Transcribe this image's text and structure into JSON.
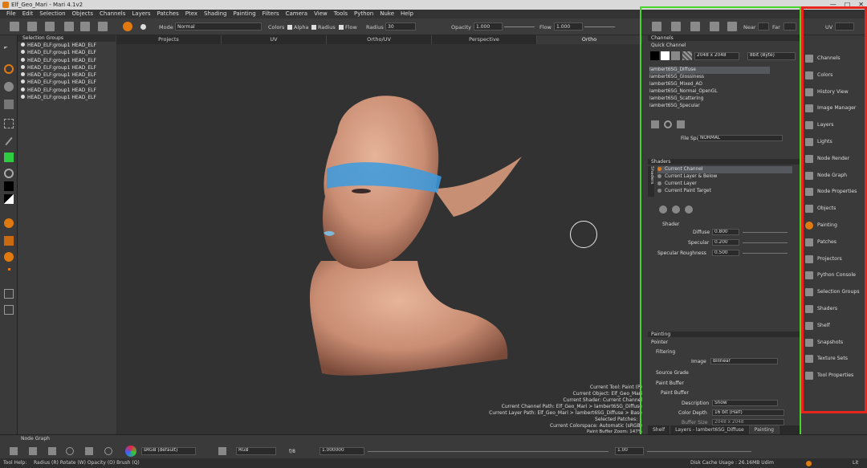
{
  "titlebar": {
    "title": "Elf_Geo_Mari - Mari 4.1v2",
    "min": "—",
    "max": "□",
    "close": "✕"
  },
  "menu": [
    "File",
    "Edit",
    "Selection",
    "Objects",
    "Channels",
    "Layers",
    "Patches",
    "Ptex",
    "Shading",
    "Painting",
    "Filters",
    "Camera",
    "View",
    "Tools",
    "Python",
    "Nuke",
    "Help"
  ],
  "toolbar": {
    "mode_label": "Mode",
    "mode_value": "Normal",
    "colors_label": "Colors",
    "alpha_label": "Alpha",
    "radius_chk_label": "Radius",
    "flow_chk_label": "Flow",
    "radius_label": "Radius",
    "radius_value": "30",
    "opacity_label": "Opacity",
    "opacity_value": "1.000",
    "flow_label": "Flow",
    "flow_value": "1.000",
    "near_label": "Near",
    "far_label": "Far",
    "uv_label": "UV"
  },
  "selection_groups": {
    "header": "Selection Groups",
    "rows": [
      "HEAD_ELF:group1  HEAD_ELF",
      "HEAD_ELF:group1  HEAD_ELF",
      "HEAD_ELF:group1  HEAD_ELF",
      "HEAD_ELF:group1  HEAD_ELF",
      "HEAD_ELF:group1  HEAD_ELF",
      "HEAD_ELF:group1  HEAD_ELF",
      "HEAD_ELF:group1  HEAD_ELF",
      "HEAD_ELF:group1  HEAD_ELF"
    ]
  },
  "view_tabs": [
    "Projects",
    "UV",
    "Ortho/UV",
    "Perspective",
    "Ortho"
  ],
  "viewport_info": [
    "Current Tool: Paint (P)",
    "Current Object: Elf_Geo_Mari",
    "Current Shader: Current Channel",
    "Current Channel Path: Elf_Geo_Mari > lambert6SG_Diffuse",
    "Current Layer Path: Elf_Geo_Mari > lambert6SG_Diffuse > Base",
    "Selected Patches: 1",
    "Current Colorspace: Automatic (sRGB)",
    "Paint Buffer Zoom: 147%"
  ],
  "channels": {
    "header": "Channels",
    "quick": "Quick Channel",
    "size": "2048 x 2048",
    "depth": "8bit (Byte)",
    "list": [
      "lambert6SG_Diffuse",
      "lambert6SG_Glossiness",
      "lambert6SG_Mixed_AO",
      "lambert6SG_Normal_OpenGL",
      "lambert6SG_Scattering",
      "lambert6SG_Specular"
    ]
  },
  "filespace": {
    "label": "File Space",
    "value": "NORMAL"
  },
  "shaders": {
    "header": "Shaders",
    "side_tab": "Shaders",
    "list": [
      "Current Channel",
      "Current Layer & Below",
      "Current Layer",
      "Current Paint Target"
    ],
    "shader_label": "Shader",
    "params": [
      {
        "label": "Diffuse",
        "value": "0.800"
      },
      {
        "label": "Specular",
        "value": "0.200"
      },
      {
        "label": "Specular Roughness",
        "value": "0.500"
      }
    ]
  },
  "painting": {
    "header": "Painting",
    "pointer": "Pointer",
    "filtering": "Filtering",
    "image_label": "Image",
    "image_value": "Bilinear",
    "source_grade": "Source Grade",
    "paint_buffer": "Paint Buffer",
    "paint_buffer_sub": "Paint Buffer",
    "description_label": "Description",
    "description_value": "Show",
    "color_depth_label": "Color Depth",
    "color_depth_value": "16 bit (Half)",
    "buffer_size_label": "Buffer Size",
    "buffer_size_value": "2048 x 2048"
  },
  "bottom_tabs": [
    "Shelf",
    "Layers - lambert6SG_Diffuse",
    "Painting"
  ],
  "palettes": [
    "Channels",
    "Colors",
    "History View",
    "Image Manager",
    "Layers",
    "Lights",
    "Node Render",
    "Node Graph",
    "Node Properties",
    "Objects",
    "Painting",
    "Patches",
    "Projectors",
    "Python Console",
    "Selection Groups",
    "Shaders",
    "Shelf",
    "Snapshots",
    "Texture Sets",
    "Tool Properties"
  ],
  "bottom": {
    "node_graph": "Node Graph",
    "colorspace": "sRGB (default)",
    "channel_mode": "RGB",
    "fstop": "f/8",
    "exposure": "1.000000",
    "gain": "1.00"
  },
  "status": {
    "tool_help": "Tool Help:",
    "hints": "Radius (R)   Rotate (W)   Opacity (O)   Brush (Q)",
    "cache": "Disk Cache Usage : 26.16MB Udim",
    "lit": "Lit"
  },
  "colors": {
    "accent": "#e07a10",
    "green_highlight": "#46d62a",
    "red_highlight": "#e8241c",
    "brush_stroke": "#3a9be0"
  }
}
